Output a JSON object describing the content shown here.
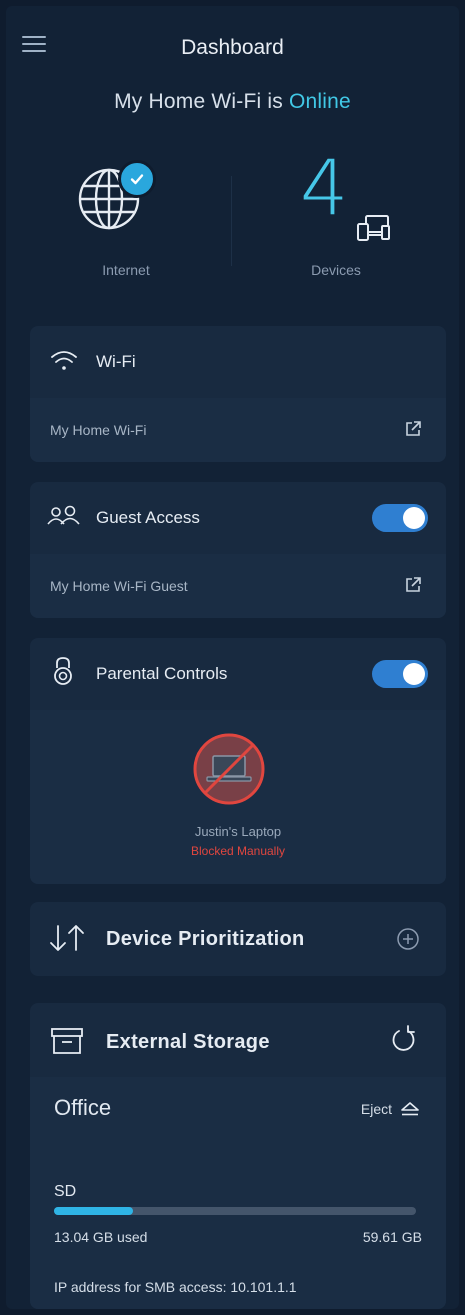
{
  "header": {
    "title": "Dashboard",
    "status_prefix": "My Home Wi-Fi is ",
    "status_value": "Online"
  },
  "summary": {
    "internet_label": "Internet",
    "devices_count": "4",
    "devices_label": "Devices"
  },
  "wifi": {
    "title": "Wi-Fi",
    "network_name": "My Home Wi-Fi"
  },
  "guest": {
    "title": "Guest Access",
    "network_name": "My Home Wi-Fi Guest",
    "enabled": true
  },
  "parental": {
    "title": "Parental Controls",
    "enabled": true,
    "device_name": "Justin's Laptop",
    "device_state": "Blocked Manually"
  },
  "prioritization": {
    "title": "Device Prioritization"
  },
  "storage": {
    "title": "External Storage",
    "drive_name": "Office",
    "eject_label": "Eject",
    "volume": "SD",
    "used": "13.04 GB used",
    "total": "59.61 GB",
    "used_fraction": 0.219,
    "ip_text": "IP address for SMB access: 10.101.1.1"
  },
  "colors": {
    "accent": "#41c8e6",
    "toggle_on": "#2f7fd1",
    "blocked": "#e0463f",
    "background": "#122236",
    "card": "#182a40"
  }
}
